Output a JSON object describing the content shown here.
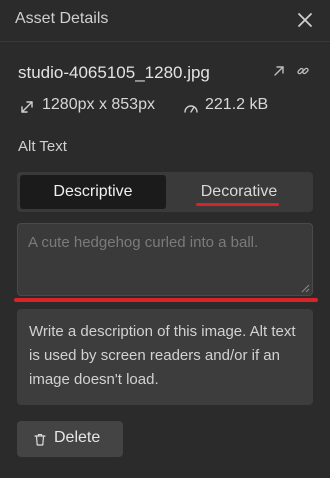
{
  "header": {
    "title": "Asset Details",
    "close_icon": "close-icon"
  },
  "asset": {
    "file_name": "studio-4065105_1280.jpg",
    "dimensions": "1280px x 853px",
    "file_size": "221.2 kB",
    "icons": [
      "open-in-new-icon",
      "link-icon",
      "dimensions-icon",
      "gauge-icon"
    ]
  },
  "alt_text": {
    "label": "Alt Text",
    "tabs": [
      {
        "label": "Descriptive",
        "selected": true
      },
      {
        "label": "Decorative",
        "selected": false
      }
    ],
    "placeholder": "A cute hedgehog curled into a ball.",
    "value": "",
    "hint": "Write a description of this image. Alt text is used by screen readers and/or if an image doesn't load."
  },
  "actions": {
    "delete_label": "Delete",
    "delete_icon": "trash-icon"
  },
  "colors": {
    "background": "#2b2b2b",
    "selected_tab": "#1b1b1b",
    "annotation_red": "#d6242a"
  }
}
